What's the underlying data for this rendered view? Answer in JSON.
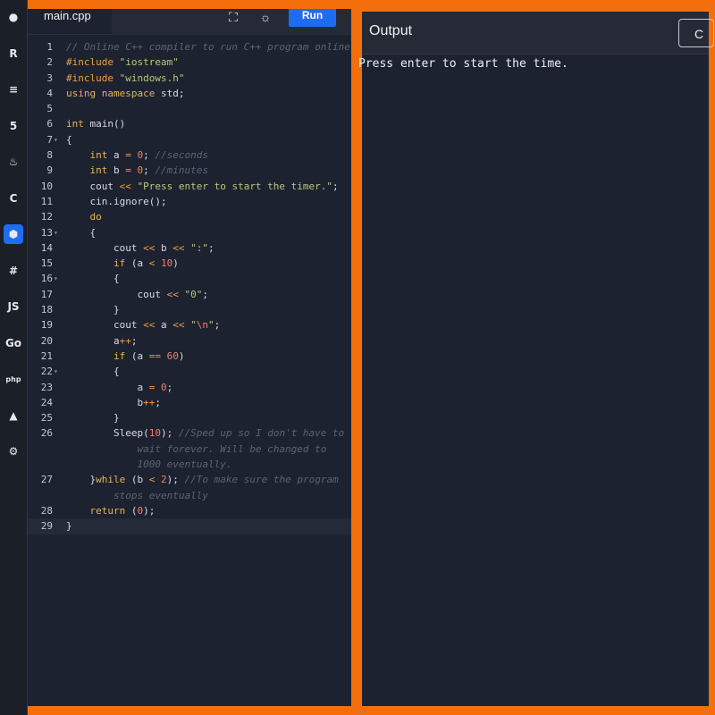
{
  "editor": {
    "file_tab": "main.cpp",
    "run_label": "Run",
    "lines": [
      {
        "n": "1",
        "fold": "",
        "html": "<span class=\"cmt\">// Online C++ compiler to run C++ program online</span>"
      },
      {
        "n": "2",
        "fold": "",
        "html": "<span class=\"pre\">#include</span> <span class=\"str\">\"iostream\"</span>"
      },
      {
        "n": "3",
        "fold": "",
        "html": "<span class=\"pre\">#include</span> <span class=\"str\">\"windows.h\"</span>"
      },
      {
        "n": "4",
        "fold": "",
        "html": "<span class=\"kw\">using namespace</span> std;"
      },
      {
        "n": "5",
        "fold": "",
        "html": ""
      },
      {
        "n": "6",
        "fold": "",
        "html": "<span class=\"kw\">int</span> main()"
      },
      {
        "n": "7",
        "fold": "▾",
        "html": "{"
      },
      {
        "n": "8",
        "fold": "",
        "html": "    <span class=\"kw\">int</span> a <span class=\"op\">=</span> <span class=\"num\">0</span>; <span class=\"cmt\">//seconds</span>"
      },
      {
        "n": "9",
        "fold": "",
        "html": "    <span class=\"kw\">int</span> b <span class=\"op\">=</span> <span class=\"num\">0</span>; <span class=\"cmt\">//minutes</span>"
      },
      {
        "n": "10",
        "fold": "",
        "html": "    cout <span class=\"op\">&lt;&lt;</span> <span class=\"str\">\"Press enter to start the timer.\"</span>;"
      },
      {
        "n": "11",
        "fold": "",
        "html": "    cin.ignore();"
      },
      {
        "n": "12",
        "fold": "",
        "html": "    <span class=\"kw\">do</span>"
      },
      {
        "n": "13",
        "fold": "▾",
        "html": "    {"
      },
      {
        "n": "14",
        "fold": "",
        "html": "        cout <span class=\"op\">&lt;&lt;</span> b <span class=\"op\">&lt;&lt;</span> <span class=\"str\">\":\"</span>;"
      },
      {
        "n": "15",
        "fold": "",
        "html": "        <span class=\"kw\">if</span> (a <span class=\"op\">&lt;</span> <span class=\"num\">10</span>)"
      },
      {
        "n": "16",
        "fold": "▾",
        "html": "        {"
      },
      {
        "n": "17",
        "fold": "",
        "html": "            cout <span class=\"op\">&lt;&lt;</span> <span class=\"str\">\"0\"</span>;"
      },
      {
        "n": "18",
        "fold": "",
        "html": "        }"
      },
      {
        "n": "19",
        "fold": "",
        "html": "        cout <span class=\"op\">&lt;&lt;</span> a <span class=\"op\">&lt;&lt;</span> <span class=\"str\">\"<span class=\"num\">\\n</span>\"</span>;"
      },
      {
        "n": "20",
        "fold": "",
        "html": "        a<span class=\"op\">++</span>;"
      },
      {
        "n": "21",
        "fold": "",
        "html": "        <span class=\"kw\">if</span> (a <span class=\"op\">==</span> <span class=\"num\">60</span>)"
      },
      {
        "n": "22",
        "fold": "▾",
        "html": "        {"
      },
      {
        "n": "23",
        "fold": "",
        "html": "            a <span class=\"op\">=</span> <span class=\"num\">0</span>;"
      },
      {
        "n": "24",
        "fold": "",
        "html": "            b<span class=\"op\">++</span>;"
      },
      {
        "n": "25",
        "fold": "",
        "html": "        }"
      },
      {
        "n": "26",
        "fold": "",
        "html": "        Sleep(<span class=\"num\">10</span>); <span class=\"cmt\">//Sped up so I don't have to\n            wait forever. Will be changed to\n            1000 eventually.</span>"
      },
      {
        "n": "27",
        "fold": "",
        "html": "    }<span class=\"kw\">while</span> (b <span class=\"op\">&lt;</span> <span class=\"num\">2</span>); <span class=\"cmt\">//To make sure the program\n        stops eventually</span>"
      },
      {
        "n": "28",
        "fold": "",
        "html": "    <span class=\"kw\">return</span> (<span class=\"num\">0</span>);"
      },
      {
        "n": "29",
        "fold": "",
        "html": "}",
        "active": true
      }
    ]
  },
  "output": {
    "title": "Output",
    "clear_label": "C",
    "text": "Press enter to start the time."
  },
  "sidebar_icons": [
    {
      "name": "python-icon",
      "glyph": "●",
      "active": false
    },
    {
      "name": "r-lang-icon",
      "glyph": "R",
      "active": false
    },
    {
      "name": "sql-icon",
      "glyph": "≡",
      "active": false
    },
    {
      "name": "html-icon",
      "glyph": "5",
      "active": false
    },
    {
      "name": "java-icon",
      "glyph": "♨",
      "active": false
    },
    {
      "name": "c-lang-icon",
      "glyph": "C",
      "active": false
    },
    {
      "name": "cpp-icon",
      "glyph": "⬢",
      "active": true
    },
    {
      "name": "csharp-icon",
      "glyph": "#",
      "active": false
    },
    {
      "name": "javascript-icon",
      "glyph": "JS",
      "active": false
    },
    {
      "name": "go-icon",
      "glyph": "Go",
      "active": false
    },
    {
      "name": "php-icon",
      "glyph": "php",
      "active": false
    },
    {
      "name": "swift-icon",
      "glyph": "▲",
      "active": false
    },
    {
      "name": "rust-icon",
      "glyph": "⚙",
      "active": false
    }
  ],
  "colors": {
    "accent": "#1e6cf1",
    "frame": "#f46f0c",
    "editor_bg": "#1d2230"
  }
}
